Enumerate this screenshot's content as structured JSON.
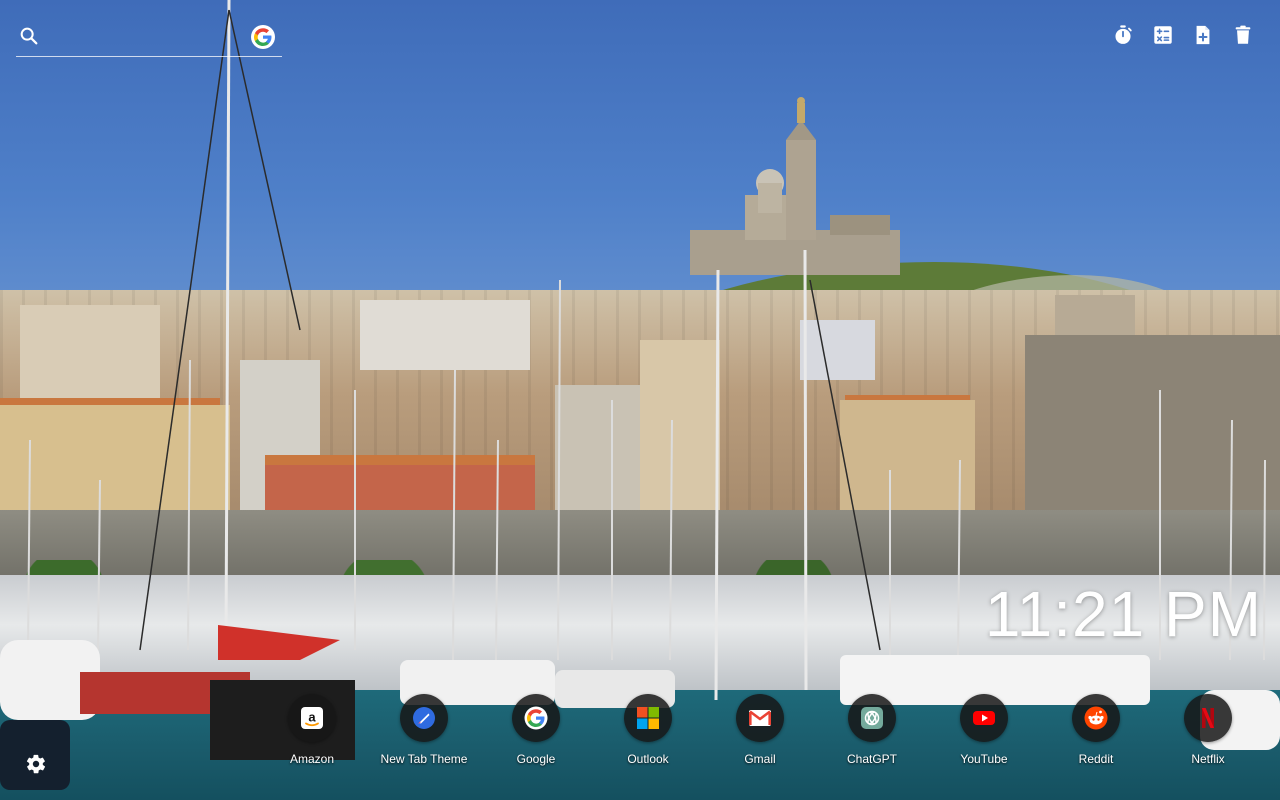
{
  "search": {
    "placeholder": "",
    "icon": "search-icon",
    "engine_icon": "google-g-icon"
  },
  "toolbar": {
    "items": [
      {
        "name": "timer",
        "icon": "stopwatch-icon"
      },
      {
        "name": "calculator",
        "icon": "calculator-icon"
      },
      {
        "name": "new-note",
        "icon": "note-add-icon"
      },
      {
        "name": "trash",
        "icon": "trash-icon"
      }
    ]
  },
  "clock": {
    "time": "11:21 PM"
  },
  "shortcuts": [
    {
      "label": "Amazon",
      "icon": "amazon-icon"
    },
    {
      "label": "New Tab Theme",
      "icon": "new-tab-theme-icon"
    },
    {
      "label": "Google",
      "icon": "google-icon"
    },
    {
      "label": "Outlook",
      "icon": "microsoft-icon"
    },
    {
      "label": "Gmail",
      "icon": "gmail-icon"
    },
    {
      "label": "ChatGPT",
      "icon": "chatgpt-icon"
    },
    {
      "label": "YouTube",
      "icon": "youtube-icon"
    },
    {
      "label": "Reddit",
      "icon": "reddit-icon"
    },
    {
      "label": "Netflix",
      "icon": "netflix-icon"
    }
  ],
  "settings": {
    "icon": "gear-icon"
  },
  "background": {
    "scene": "Marseille Old Port with Notre-Dame de la Garde",
    "colors": {
      "sky": "#4a79c4",
      "water": "#1a5b6b",
      "hill": "#5d7b38"
    }
  }
}
